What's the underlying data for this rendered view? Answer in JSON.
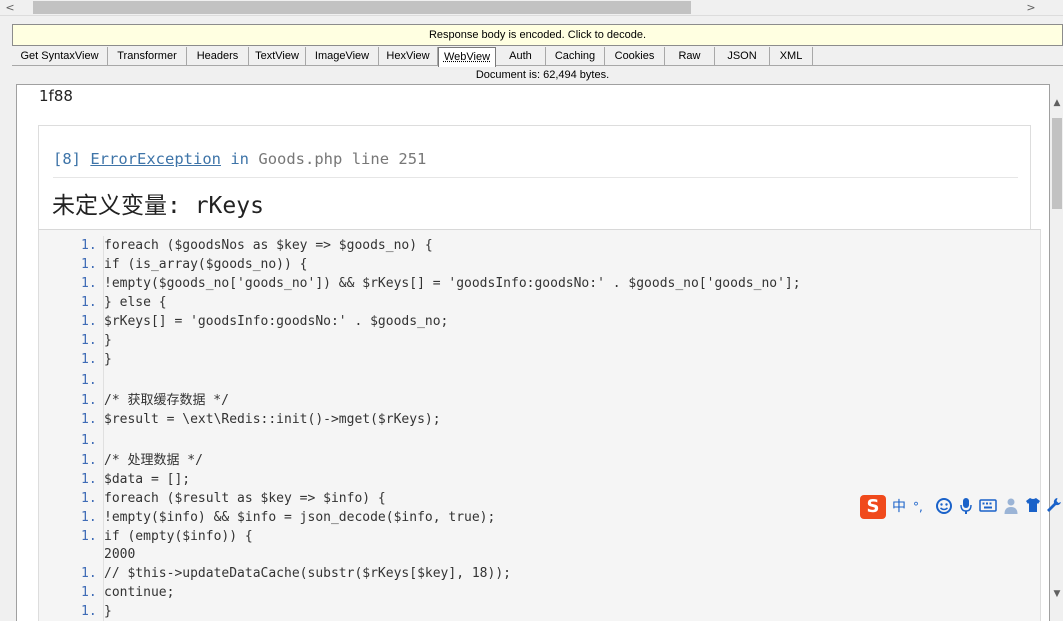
{
  "scroll": {
    "left_arrow": "<",
    "right_arrow": ">",
    "up_arrow": "▲",
    "down_arrow": "▼"
  },
  "notice": "Response body is encoded. Click to decode.",
  "tabs": [
    {
      "label": "Get SyntaxView",
      "active": false
    },
    {
      "label": "Transformer",
      "active": false
    },
    {
      "label": "Headers",
      "active": false
    },
    {
      "label": "TextView",
      "active": false
    },
    {
      "label": "ImageView",
      "active": false
    },
    {
      "label": "HexView",
      "active": false
    },
    {
      "label": "WebView",
      "active": true
    },
    {
      "label": "Auth",
      "active": false
    },
    {
      "label": "Caching",
      "active": false
    },
    {
      "label": "Cookies",
      "active": false
    },
    {
      "label": "Raw",
      "active": false
    },
    {
      "label": "JSON",
      "active": false
    },
    {
      "label": "XML",
      "active": false
    }
  ],
  "document_info": "Document is: 62,494 bytes.",
  "webview": {
    "chunk_size": "1f88",
    "error": {
      "code": "[8]",
      "exception": "ErrorException",
      "in_word": "in",
      "file": "Goods.php",
      "line_word": "line",
      "line_no": "251",
      "message": "未定义变量: rKeys"
    },
    "code_lines": [
      {
        "num": "1.",
        "text": "foreach ($goodsNos as $key => $goods_no) {"
      },
      {
        "num": "1.",
        "text": "if (is_array($goods_no)) {"
      },
      {
        "num": "1.",
        "text": "!empty($goods_no['goods_no']) && $rKeys[] = 'goodsInfo:goodsNo:' . $goods_no['goods_no'];"
      },
      {
        "num": "1.",
        "text": "} else {"
      },
      {
        "num": "1.",
        "text": "$rKeys[] = 'goodsInfo:goodsNo:' . $goods_no;"
      },
      {
        "num": "1.",
        "text": "}"
      },
      {
        "num": "1.",
        "text": "}"
      },
      {
        "num": "1.",
        "text": ""
      },
      {
        "num": "1.",
        "text": "/* 获取缓存数据 */"
      },
      {
        "num": "1.",
        "text": "$result = \\ext\\Redis::init()->mget($rKeys);"
      },
      {
        "num": "1.",
        "text": ""
      },
      {
        "num": "1.",
        "text": "/* 处理数据 */"
      },
      {
        "num": "1.",
        "text": "$data = [];"
      },
      {
        "num": "1.",
        "text": "foreach ($result as $key => $info) {"
      },
      {
        "num": "1.",
        "text": "!empty($info) && $info = json_decode($info, true);"
      },
      {
        "num": "1.",
        "text": "if (empty($info)) {"
      },
      {
        "num": "",
        "text": "2000"
      },
      {
        "num": "1.",
        "text": "// $this->updateDataCache(substr($rKeys[$key], 18));"
      },
      {
        "num": "1.",
        "text": "continue;"
      },
      {
        "num": "1.",
        "text": "}"
      }
    ]
  },
  "ime_toolbar": {
    "logo": "S",
    "mode": "中",
    "punct": "°,",
    "items": [
      "emoji-icon",
      "microphone-icon",
      "keyboard-icon",
      "user-icon",
      "shirt-icon",
      "wrench-icon"
    ]
  }
}
